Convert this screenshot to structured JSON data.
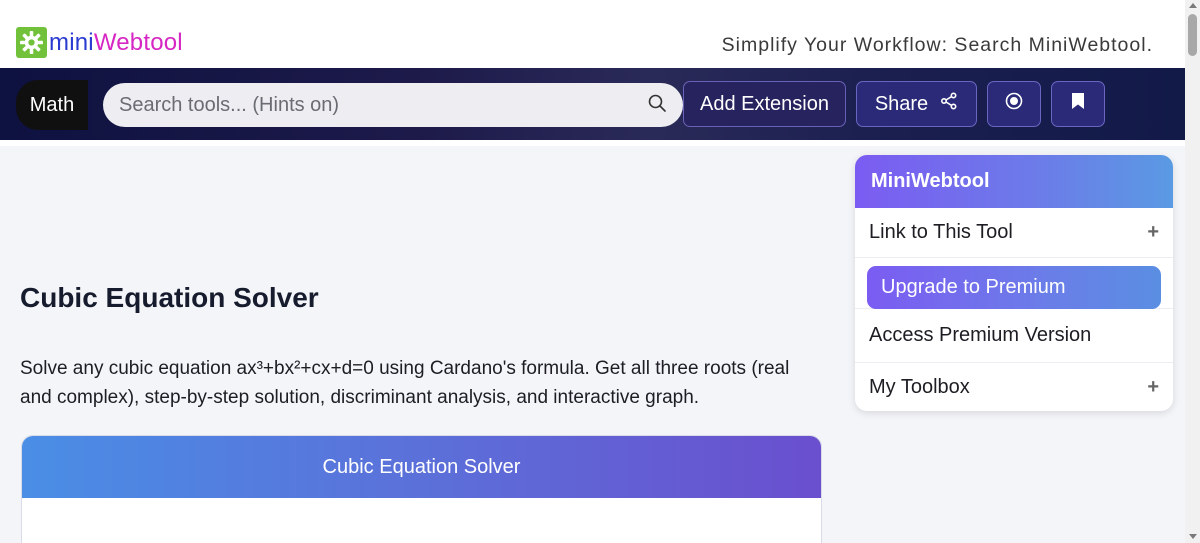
{
  "header": {
    "logo_part1": "mini",
    "logo_part2": "Webtool",
    "logo_icon": "gear-icon",
    "tagline": "Simplify Your Workflow: Search MiniWebtool."
  },
  "navbar": {
    "category_label": "Math",
    "search_placeholder": "Search tools... (Hints on)",
    "search_icon": "search-icon",
    "add_extension_label": "Add Extension",
    "share_label": "Share",
    "share_icon": "share-icon",
    "record_icon": "record-icon",
    "bookmark_icon": "bookmark-icon"
  },
  "main": {
    "title": "Cubic Equation Solver",
    "description": "Solve any cubic equation ax³+bx²+cx+d=0 using Cardano's formula. Get all three roots (real and complex), step-by-step solution, discriminant analysis, and interactive graph.",
    "card_title": "Cubic Equation Solver"
  },
  "sidebar": {
    "title": "MiniWebtool",
    "items": [
      {
        "label": "Link to This Tool",
        "expand": "+"
      },
      {
        "label": "Upgrade to Premium"
      },
      {
        "label": "Access Premium Version"
      },
      {
        "label": "My Toolbox",
        "expand": "+"
      }
    ]
  },
  "colors": {
    "logo_mini": "#2a3bd1",
    "logo_web": "#d627c4",
    "logo_gear_bg": "#71c23a",
    "navbar_bg": "#1a1d4c",
    "accent_purple": "#7b5cf2",
    "accent_blue": "#5a9ae3"
  }
}
